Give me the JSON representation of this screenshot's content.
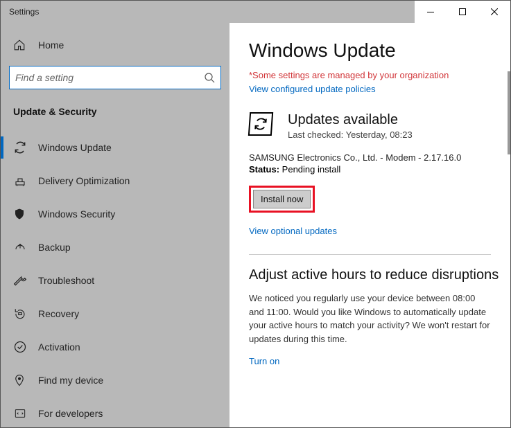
{
  "window": {
    "title": "Settings"
  },
  "sidebar": {
    "home": "Home",
    "search_placeholder": "Find a setting",
    "category": "Update & Security",
    "items": [
      {
        "label": "Windows Update"
      },
      {
        "label": "Delivery Optimization"
      },
      {
        "label": "Windows Security"
      },
      {
        "label": "Backup"
      },
      {
        "label": "Troubleshoot"
      },
      {
        "label": "Recovery"
      },
      {
        "label": "Activation"
      },
      {
        "label": "Find my device"
      },
      {
        "label": "For developers"
      }
    ]
  },
  "main": {
    "title": "Windows Update",
    "managed_warning": "*Some settings are managed by your organization",
    "configured_link": "View configured update policies",
    "updates_available": "Updates available",
    "last_checked": "Last checked: Yesterday, 08:23",
    "driver": "SAMSUNG Electronics Co., Ltd.  - Modem - 2.17.16.0",
    "status_label": "Status:",
    "status_value": " Pending install",
    "install_label": "Install now",
    "optional_link": "View optional updates",
    "active_hours_title": "Adjust active hours to reduce disruptions",
    "active_hours_body": "We noticed you regularly use your device between 08:00 and 11:00. Would you like Windows to automatically update your active hours to match your activity? We won't restart for updates during this time.",
    "turn_on": "Turn on"
  }
}
